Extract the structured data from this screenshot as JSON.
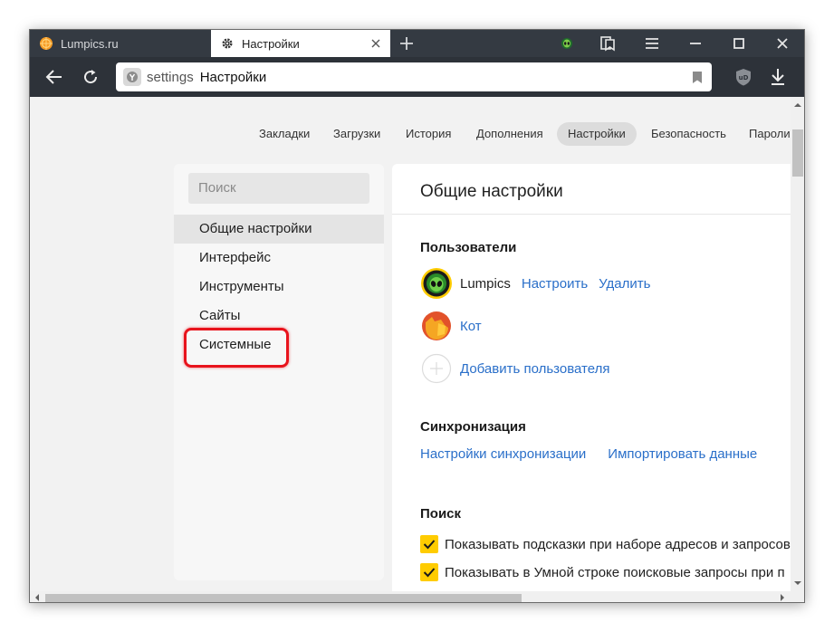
{
  "tabs": [
    {
      "title": "Lumpics.ru",
      "icon": "orange-favicon-icon"
    },
    {
      "title": "Настройки",
      "icon": "gear-icon"
    }
  ],
  "address_bar": {
    "host": "settings",
    "title": "Настройки"
  },
  "top_nav": [
    "Закладки",
    "Загрузки",
    "История",
    "Дополнения",
    "Настройки",
    "Безопасность",
    "Пароли"
  ],
  "top_nav_active": "Настройки",
  "sidebar": {
    "search_placeholder": "Поиск",
    "items": [
      "Общие настройки",
      "Интерфейс",
      "Инструменты",
      "Сайты",
      "Системные"
    ],
    "active": "Общие настройки",
    "highlighted": "Системные"
  },
  "main": {
    "title": "Общие настройки",
    "users_heading": "Пользователи",
    "users": [
      {
        "name": "Lumpics",
        "actions": [
          "Настроить",
          "Удалить"
        ]
      },
      {
        "name": "Кот"
      }
    ],
    "add_user": "Добавить пользователя",
    "sync_heading": "Синхронизация",
    "sync_links": [
      "Настройки синхронизации",
      "Импортировать данные"
    ],
    "search_heading": "Поиск",
    "search_options": [
      {
        "label": "Показывать подсказки при наборе адресов и запросов",
        "checked": true
      },
      {
        "label": "Показывать в Умной строке поисковые запросы при п",
        "checked": true
      }
    ]
  },
  "colors": {
    "accent": "#ffcc00",
    "link": "#2a6fc9",
    "highlight": "#e8131c",
    "chrome_dark": "#343a42"
  }
}
